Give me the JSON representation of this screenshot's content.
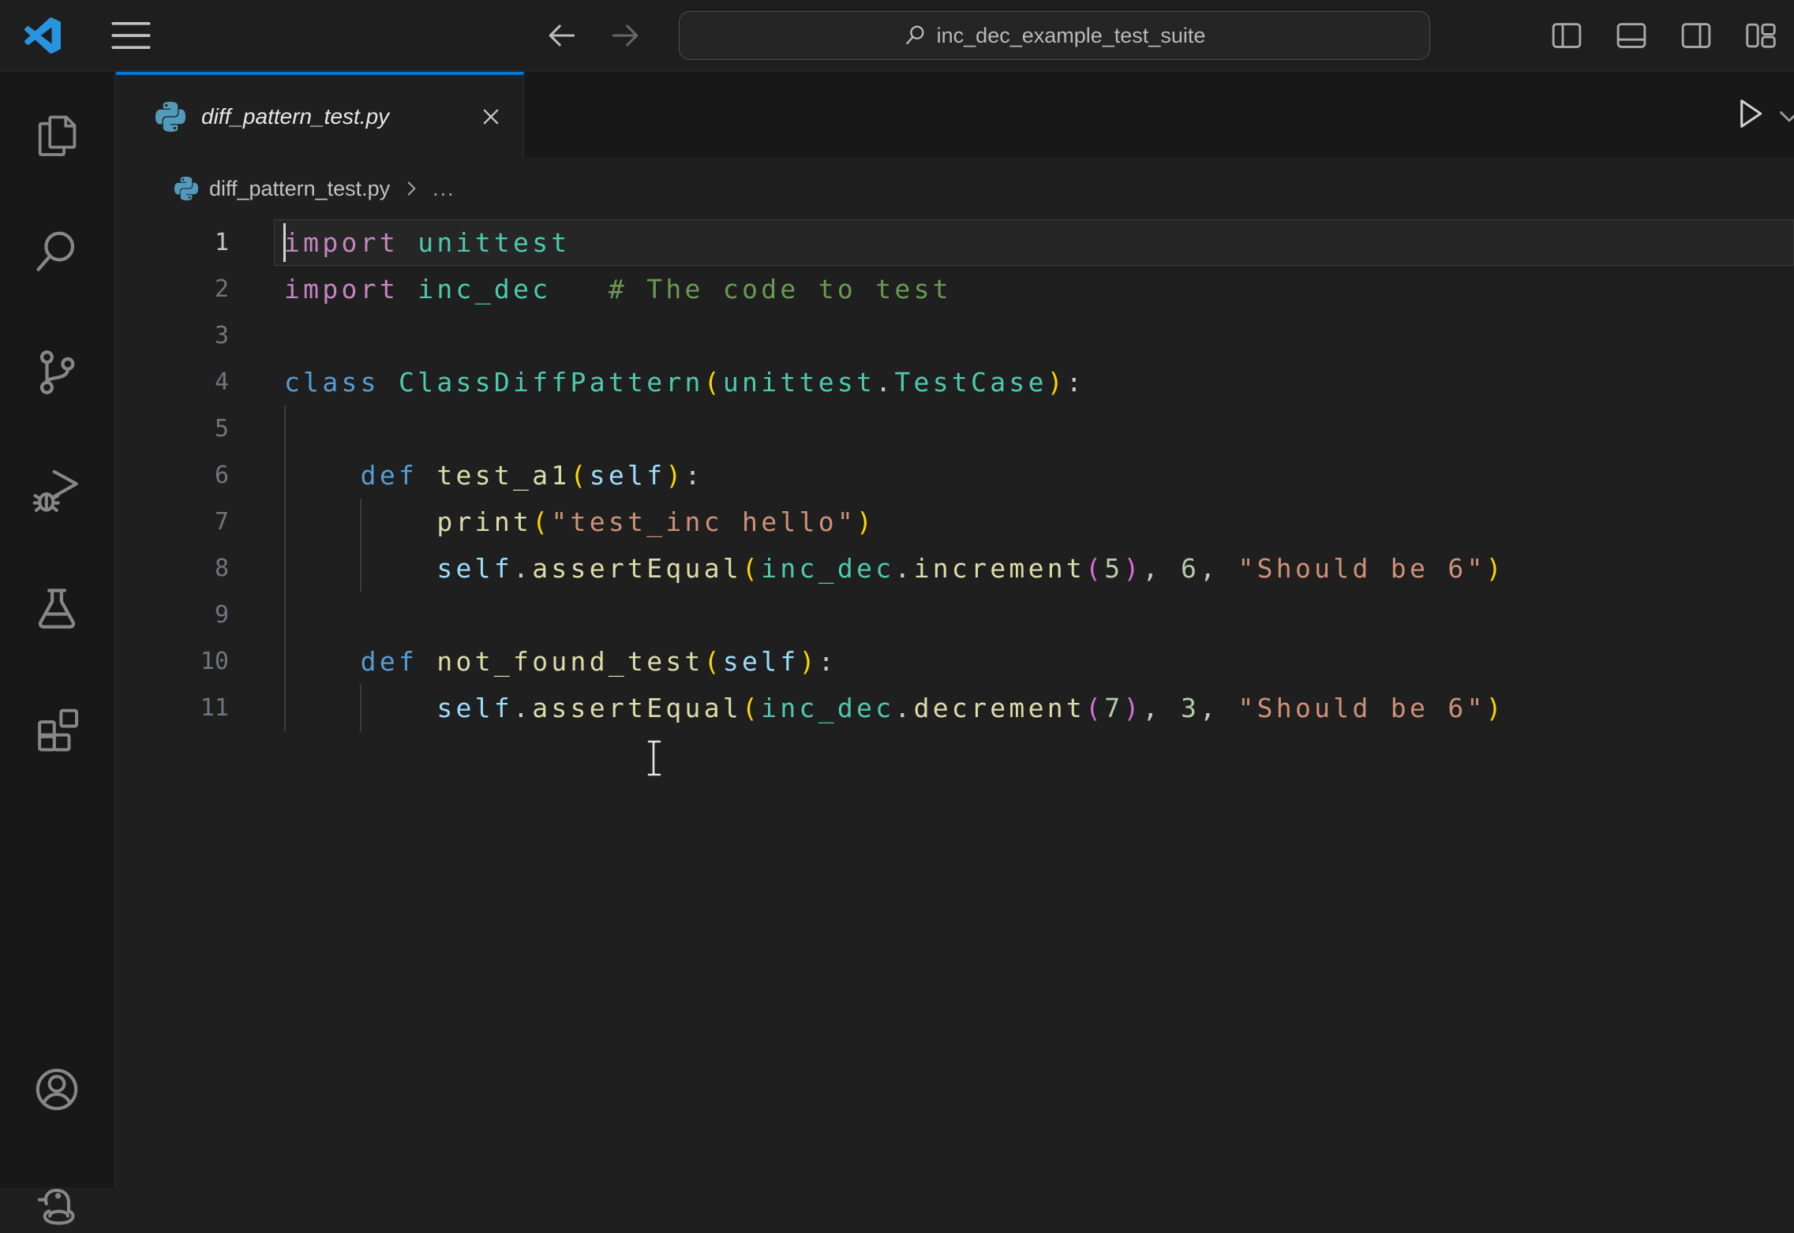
{
  "accent_color": "#0078d4",
  "titlebar": {
    "command_center_text": "inc_dec_example_test_suite",
    "icons": [
      "vscode-logo",
      "menu",
      "arrow-back",
      "arrow-forward",
      "search",
      "layout-sidebar-left",
      "layout-panel",
      "layout-sidebar-right",
      "layout-customize"
    ]
  },
  "activity_bar": {
    "items": [
      "explorer",
      "search",
      "source-control",
      "run-and-debug",
      "testing",
      "extensions"
    ],
    "bottom_items": [
      "accounts",
      "python-environments"
    ]
  },
  "tab": {
    "label": "diff_pattern_test.py",
    "icons": [
      "python-file",
      "close"
    ]
  },
  "editor_actions": {
    "icons": [
      "run-python-file",
      "chevron-down"
    ]
  },
  "breadcrumb": {
    "file": "diff_pattern_test.py",
    "more": "...",
    "icons": [
      "python-file",
      "chevron-right"
    ]
  },
  "editor": {
    "colors": {
      "kw_import": "#C586C0",
      "kw": "#569CD6",
      "type": "#4EC9B0",
      "func": "#DCDCAA",
      "self": "#9CDCFE",
      "str": "#CE9178",
      "num": "#B5CEA8",
      "comment": "#6A9955",
      "plain": "#CCCCCC",
      "paren1": "#FFD700",
      "paren2": "#DA70D6"
    },
    "indent_guides": [
      {
        "col": 0,
        "from": 5,
        "to": 11
      },
      {
        "col": 4,
        "from": 7,
        "to": 8
      },
      {
        "col": 4,
        "from": 11,
        "to": 11
      }
    ],
    "lines": [
      {
        "num": "1",
        "current": true,
        "cursor": true,
        "tokens": [
          [
            "import",
            "kw_import"
          ],
          [
            " ",
            "plain"
          ],
          [
            "unittest",
            "type"
          ]
        ]
      },
      {
        "num": "2",
        "tokens": [
          [
            "import",
            "kw_import"
          ],
          [
            " ",
            "plain"
          ],
          [
            "inc_dec",
            "type"
          ],
          [
            "   ",
            "plain"
          ],
          [
            "# The code to test",
            "comment"
          ]
        ]
      },
      {
        "num": "3",
        "tokens": []
      },
      {
        "num": "4",
        "tokens": [
          [
            "class",
            "kw"
          ],
          [
            " ",
            "plain"
          ],
          [
            "ClassDiffPattern",
            "type"
          ],
          [
            "(",
            "paren1"
          ],
          [
            "unittest",
            "type"
          ],
          [
            ".",
            "plain"
          ],
          [
            "TestCase",
            "type"
          ],
          [
            ")",
            "paren1"
          ],
          [
            ":",
            "plain"
          ]
        ]
      },
      {
        "num": "5",
        "tokens": []
      },
      {
        "num": "6",
        "tokens": [
          [
            "    ",
            "plain"
          ],
          [
            "def",
            "kw"
          ],
          [
            " ",
            "plain"
          ],
          [
            "test_a1",
            "func"
          ],
          [
            "(",
            "paren1"
          ],
          [
            "self",
            "self"
          ],
          [
            ")",
            "paren1"
          ],
          [
            ":",
            "plain"
          ]
        ]
      },
      {
        "num": "7",
        "tokens": [
          [
            "        ",
            "plain"
          ],
          [
            "print",
            "func"
          ],
          [
            "(",
            "paren1"
          ],
          [
            "\"test_inc hello\"",
            "str"
          ],
          [
            ")",
            "paren1"
          ]
        ]
      },
      {
        "num": "8",
        "tokens": [
          [
            "        ",
            "plain"
          ],
          [
            "self",
            "self"
          ],
          [
            ".",
            "plain"
          ],
          [
            "assertEqual",
            "func"
          ],
          [
            "(",
            "paren1"
          ],
          [
            "inc_dec",
            "type"
          ],
          [
            ".",
            "plain"
          ],
          [
            "increment",
            "func"
          ],
          [
            "(",
            "paren2"
          ],
          [
            "5",
            "num"
          ],
          [
            ")",
            "paren2"
          ],
          [
            ",",
            "plain"
          ],
          [
            " ",
            "plain"
          ],
          [
            "6",
            "num"
          ],
          [
            ",",
            "plain"
          ],
          [
            " ",
            "plain"
          ],
          [
            "\"Should be 6\"",
            "str"
          ],
          [
            ")",
            "paren1"
          ]
        ]
      },
      {
        "num": "9",
        "tokens": []
      },
      {
        "num": "10",
        "tokens": [
          [
            "    ",
            "plain"
          ],
          [
            "def",
            "kw"
          ],
          [
            " ",
            "plain"
          ],
          [
            "not_found_test",
            "func"
          ],
          [
            "(",
            "paren1"
          ],
          [
            "self",
            "self"
          ],
          [
            ")",
            "paren1"
          ],
          [
            ":",
            "plain"
          ]
        ]
      },
      {
        "num": "11",
        "tokens": [
          [
            "        ",
            "plain"
          ],
          [
            "self",
            "self"
          ],
          [
            ".",
            "plain"
          ],
          [
            "assertEqual",
            "func"
          ],
          [
            "(",
            "paren1"
          ],
          [
            "inc_dec",
            "type"
          ],
          [
            ".",
            "plain"
          ],
          [
            "decrement",
            "func"
          ],
          [
            "(",
            "paren2"
          ],
          [
            "7",
            "num"
          ],
          [
            ")",
            "paren2"
          ],
          [
            ",",
            "plain"
          ],
          [
            " ",
            "plain"
          ],
          [
            "3",
            "num"
          ],
          [
            ",",
            "plain"
          ],
          [
            " ",
            "plain"
          ],
          [
            "\"Should be 6\"",
            "str"
          ],
          [
            ")",
            "paren1"
          ]
        ]
      }
    ]
  }
}
